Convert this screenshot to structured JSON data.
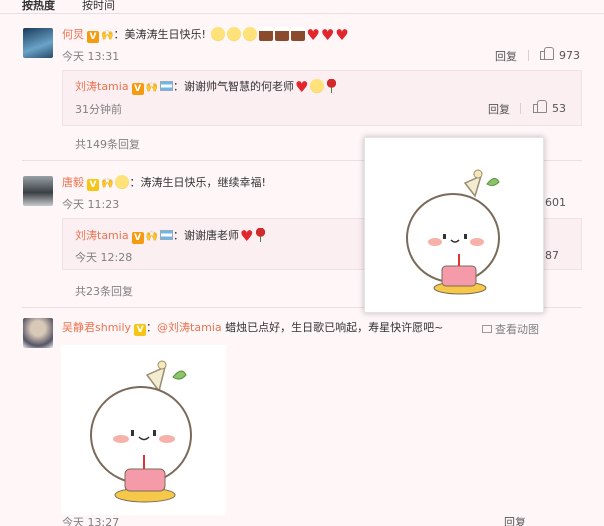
{
  "tabs": {
    "hot": "按热度",
    "time": "按时间"
  },
  "comments": [
    {
      "user": "何炅",
      "text_prefix": "：",
      "text": "美涛涛生日快乐!",
      "time": "今天 13:31",
      "reply_label": "回复",
      "likes": "973",
      "replies": [
        {
          "user": "刘涛tamia",
          "text_prefix": "：",
          "text": "谢谢帅气智慧的何老师",
          "time": "31分钟前",
          "reply_label": "回复",
          "likes": "53"
        }
      ],
      "more": "共149条回复"
    },
    {
      "user": "唐毅",
      "text_prefix": "：",
      "text": "涛涛生日快乐，继续幸福!",
      "time": "今天 11:23",
      "likes": "601",
      "replies": [
        {
          "user": "刘涛tamia",
          "text_prefix": "：",
          "text": "谢谢唐老师",
          "time": "今天 12:28",
          "likes": "87"
        }
      ],
      "more": "共23条回复"
    },
    {
      "user": "吴静君shmily",
      "text_prefix": "：",
      "mention": "@刘涛tamia",
      "text": " 蜡烛已点好，生日歌已响起，寿星快许愿吧~",
      "view_pic": "查看动图",
      "time": "今天 13:27",
      "reply_label": "回复"
    }
  ],
  "icons": {
    "vip": "V",
    "accent": "#eb7350"
  }
}
